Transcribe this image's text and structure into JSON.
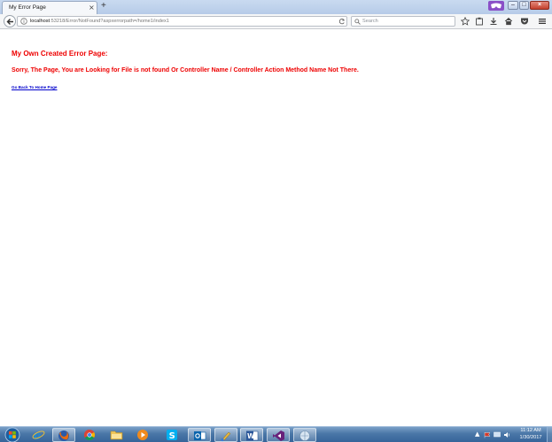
{
  "browser": {
    "tab_title": "My Error Page",
    "tab_close": "×",
    "new_tab": "+",
    "url_host": "localhost",
    "url_rest": ":53218/Error/NotFound?aspxerrorpath=/home1/index1",
    "search_placeholder": "Search",
    "window_buttons": {
      "minimize": "–",
      "maximize": "□",
      "close": "×"
    }
  },
  "page": {
    "heading": "My Own Created Error Page:",
    "message": "Sorry, The Page, You are Looking for File is not found Or Controller Name / Controller Action Method Name Not There.",
    "home_link": "Go Back To Home Page"
  },
  "taskbar": {
    "apps": [
      "start-orb-icon",
      "internet-explorer-icon",
      "firefox-icon",
      "chrome-icon",
      "file-explorer-icon",
      "media-player-icon",
      "skype-icon",
      "outlook-icon",
      "paint-icon",
      "word-icon",
      "visual-studio-icon",
      "network-icon"
    ],
    "time": "11:12 AM",
    "date": "1/30/2017"
  },
  "colors": {
    "error_red": "#ee0000",
    "link_blue": "#0000cc",
    "taskbar": "#4a77a7"
  }
}
